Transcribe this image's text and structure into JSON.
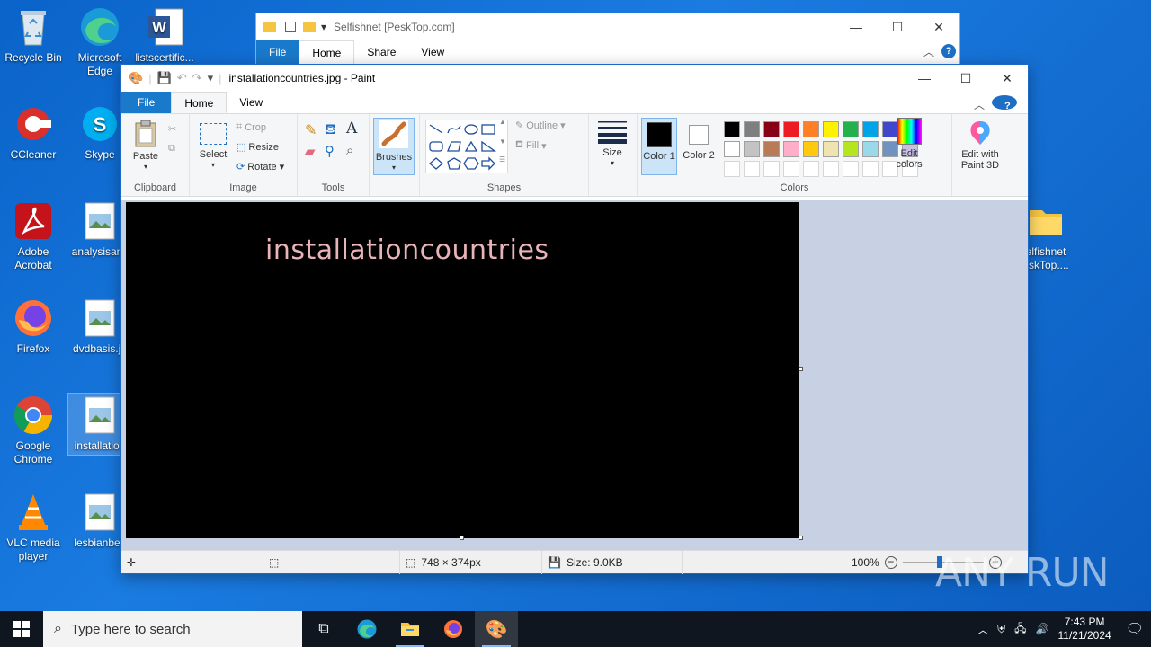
{
  "desktop": {
    "icons": [
      {
        "label": "Recycle Bin"
      },
      {
        "label": "Microsoft Edge"
      },
      {
        "label": "listscertific..."
      },
      {
        "label": "CCleaner"
      },
      {
        "label": "Skype"
      },
      {
        "label": "Adobe Acrobat"
      },
      {
        "label": "analysisany"
      },
      {
        "label": "Firefox"
      },
      {
        "label": "dvdbasis.jp"
      },
      {
        "label": "Google Chrome"
      },
      {
        "label": "installation"
      },
      {
        "label": "VLC media player"
      },
      {
        "label": "lesbianbelt"
      },
      {
        "label": "elfishnet eskTop...."
      }
    ]
  },
  "explorer": {
    "title": "Selfishnet [PeskTop.com]",
    "tabs": [
      "File",
      "Home",
      "Share",
      "View"
    ]
  },
  "paint": {
    "title": "installationcountries.jpg - Paint",
    "tabs": [
      "File",
      "Home",
      "View"
    ],
    "ribbon": {
      "clipboard": {
        "paste": "Paste",
        "group": "Clipboard"
      },
      "image": {
        "select": "Select",
        "crop": "Crop",
        "resize": "Resize",
        "rotate": "Rotate",
        "group": "Image"
      },
      "tools": {
        "group": "Tools"
      },
      "brushes": "Brushes",
      "shapes": {
        "outline": "Outline",
        "fill": "Fill",
        "group": "Shapes"
      },
      "size": "Size",
      "color1": "Color 1",
      "color2": "Color 2",
      "colors_group": "Colors",
      "edit_colors": "Edit colors",
      "edit_paint3d": "Edit with Paint 3D",
      "palette_row1": [
        "#000000",
        "#7f7f7f",
        "#880015",
        "#ed1c24",
        "#ff7f27",
        "#fff200",
        "#22b14c",
        "#00a2e8",
        "#3f48cc",
        "#a349a4"
      ],
      "palette_row2": [
        "#ffffff",
        "#c3c3c3",
        "#b97a57",
        "#ffaec9",
        "#ffc90e",
        "#efe4b0",
        "#b5e61d",
        "#99d9ea",
        "#7092be",
        "#c8bfe7"
      ]
    },
    "canvas_text": "installationcountries",
    "status": {
      "dimensions": "748 × 374px",
      "size": "Size: 9.0KB",
      "zoom": "100%"
    }
  },
  "taskbar": {
    "search_placeholder": "Type here to search",
    "time": "7:43 PM",
    "date": "11/21/2024"
  },
  "watermark": "ANY RUN"
}
